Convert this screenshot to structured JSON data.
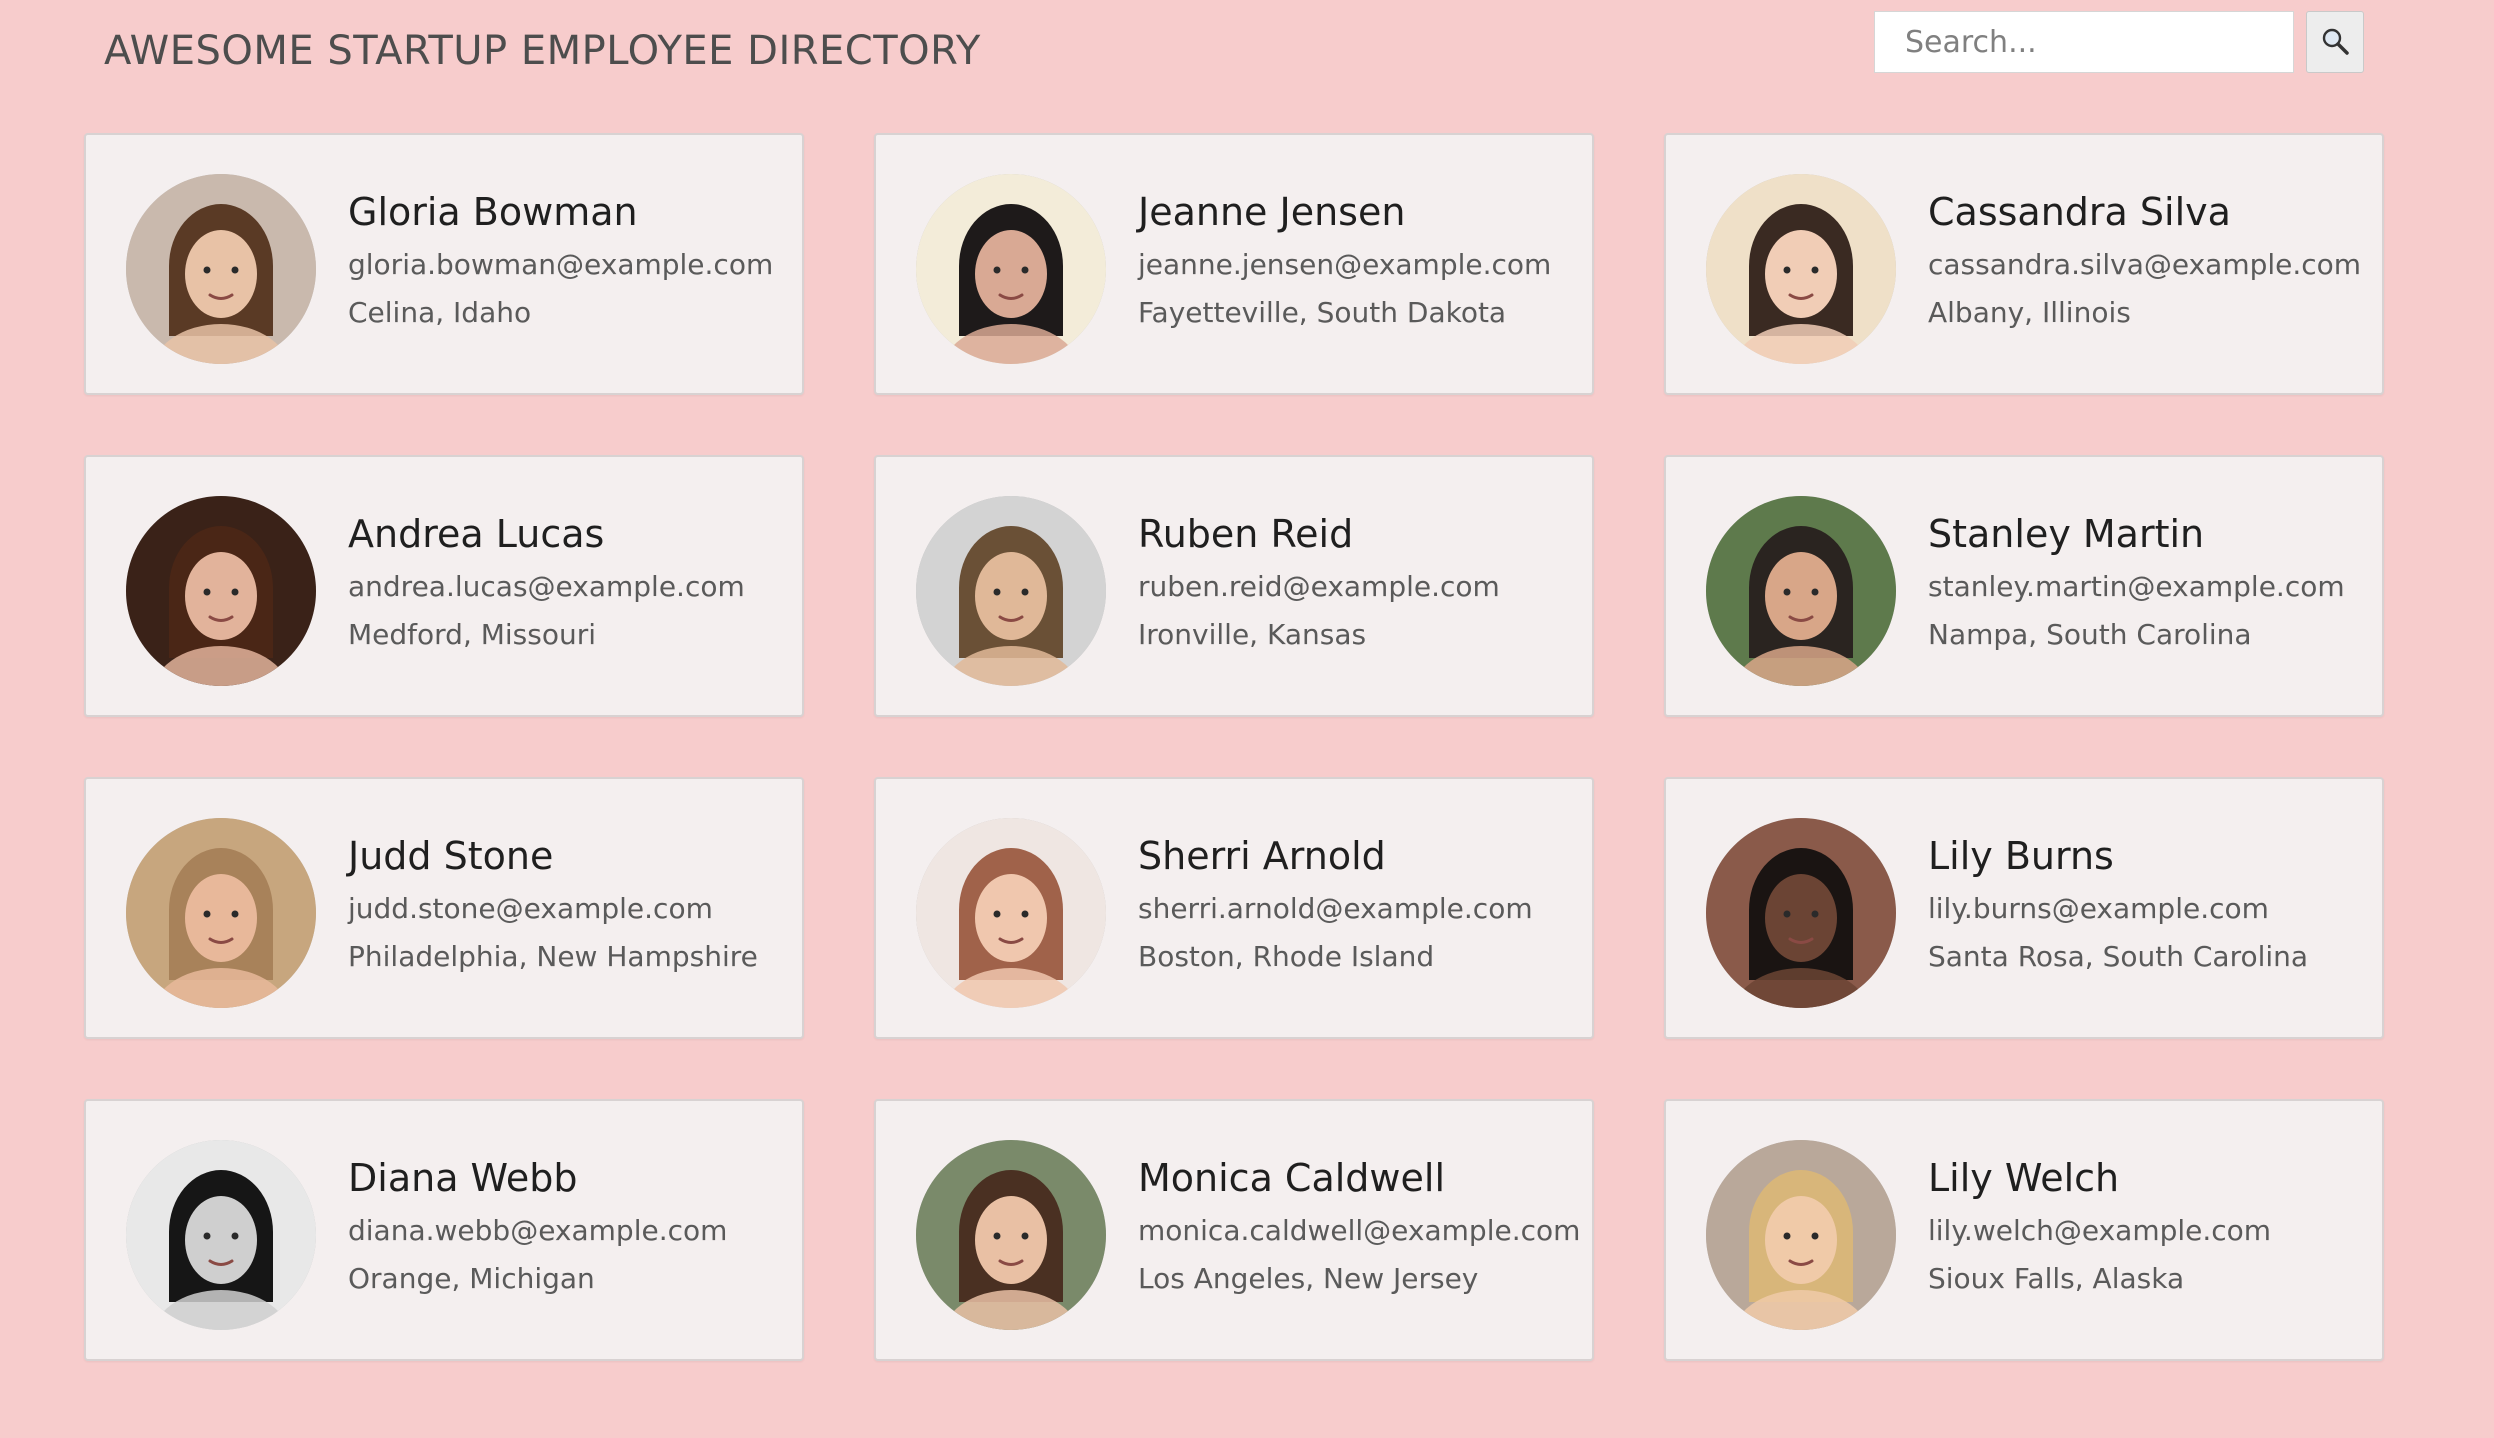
{
  "header": {
    "title": "AWESOME STARTUP EMPLOYEE DIRECTORY",
    "search_placeholder": "Search...",
    "search_icon": "magnifier-icon"
  },
  "employees": [
    {
      "name": "Gloria Bowman",
      "email": "gloria.bowman@example.com",
      "location": "Celina, Idaho",
      "avatar": {
        "bg": "#c9b9ad",
        "skin": "#e8c2a6",
        "hair": "#5a3a25"
      }
    },
    {
      "name": "Jeanne Jensen",
      "email": "jeanne.jensen@example.com",
      "location": "Fayetteville, South Dakota",
      "avatar": {
        "bg": "#f3ecd9",
        "skin": "#d9a994",
        "hair": "#1e1a1a"
      }
    },
    {
      "name": "Cassandra Silva",
      "email": "cassandra.silva@example.com",
      "location": "Albany, Illinois",
      "avatar": {
        "bg": "#efe0c8",
        "skin": "#f1cdb6",
        "hair": "#3a2a22"
      }
    },
    {
      "name": "Andrea Lucas",
      "email": "andrea.lucas@example.com",
      "location": "Medford, Missouri",
      "avatar": {
        "bg": "#3a2218",
        "skin": "#e2b39b",
        "hair": "#4a2616"
      }
    },
    {
      "name": "Ruben Reid",
      "email": "ruben.reid@example.com",
      "location": "Ironville, Kansas",
      "avatar": {
        "bg": "#d3d3d3",
        "skin": "#e0b898",
        "hair": "#6a5036"
      }
    },
    {
      "name": "Stanley Martin",
      "email": "stanley.martin@example.com",
      "location": "Nampa, South Carolina",
      "avatar": {
        "bg": "#5e7a4c",
        "skin": "#d8a688",
        "hair": "#2a2420"
      }
    },
    {
      "name": "Judd Stone",
      "email": "judd.stone@example.com",
      "location": "Philadelphia, New Hampshire",
      "avatar": {
        "bg": "#c7a67e",
        "skin": "#e8b89a",
        "hair": "#a8825a"
      }
    },
    {
      "name": "Sherri Arnold",
      "email": "sherri.arnold@example.com",
      "location": "Boston, Rhode Island",
      "avatar": {
        "bg": "#efe6e2",
        "skin": "#f0c7ae",
        "hair": "#a0624a"
      }
    },
    {
      "name": "Lily Burns",
      "email": "lily.burns@example.com",
      "location": "Santa Rosa, South Carolina",
      "avatar": {
        "bg": "#8a5a4a",
        "skin": "#6b4434",
        "hair": "#1a1412"
      }
    },
    {
      "name": "Diana Webb",
      "email": "diana.webb@example.com",
      "location": "Orange, Michigan",
      "avatar": {
        "bg": "#e8e8e8",
        "skin": "#cfcfcf",
        "hair": "#161616"
      }
    },
    {
      "name": "Monica Caldwell",
      "email": "monica.caldwell@example.com",
      "location": "Los Angeles, New Jersey",
      "avatar": {
        "bg": "#7a8a6a",
        "skin": "#e9c0a4",
        "hair": "#4a3022"
      }
    },
    {
      "name": "Lily Welch",
      "email": "lily.welch@example.com",
      "location": "Sioux Falls, Alaska",
      "avatar": {
        "bg": "#b9a89a",
        "skin": "#f0caa8",
        "hair": "#d8b67a"
      }
    }
  ],
  "colors": {
    "page_bg": "#f7cccc",
    "card_bg": "#f4efef",
    "card_border": "#d8d2d2"
  }
}
